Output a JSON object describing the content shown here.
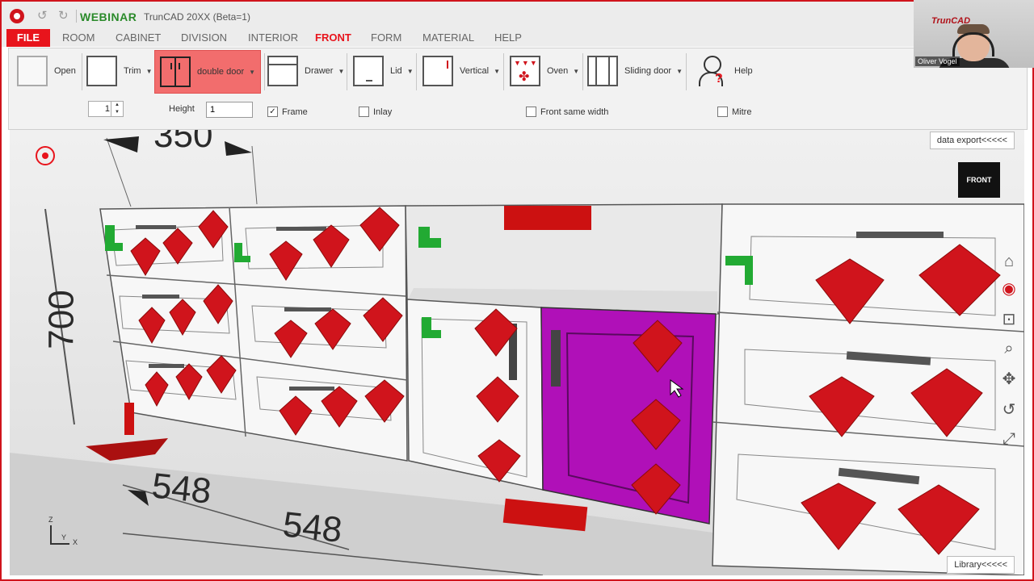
{
  "titlebar": {
    "brand": "WEBINAR",
    "app_title": "TrunCAD 20XX (Beta=1)"
  },
  "menubar": {
    "file": "FILE",
    "items": [
      "ROOM",
      "CABINET",
      "DIVISION",
      "INTERIOR",
      "FRONT",
      "FORM",
      "MATERIAL",
      "HELP"
    ],
    "active": "FRONT"
  },
  "ribbon": {
    "buttons": [
      {
        "label": "Open"
      },
      {
        "label": "Trim"
      },
      {
        "label": "double door"
      },
      {
        "label": "Drawer"
      },
      {
        "label": "Lid"
      },
      {
        "label": "Vertical"
      },
      {
        "label": "Oven"
      },
      {
        "label": "Sliding door"
      },
      {
        "label": "Help"
      }
    ],
    "active": "double door",
    "count_value": "1",
    "height_label": "Height",
    "height_value": "1",
    "options": {
      "frame": {
        "label": "Frame",
        "checked": true
      },
      "inlay": {
        "label": "Inlay",
        "checked": false
      },
      "front_same_width": {
        "label": "Front same width",
        "checked": false
      },
      "mitre": {
        "label": "Mitre",
        "checked": false
      }
    }
  },
  "viewport": {
    "data_export": "data export<<<<<",
    "library": "Library<<<<<",
    "cube_label": "FRONT",
    "dims": {
      "top": "350",
      "left": "700",
      "bottom1": "548",
      "bottom2": "548"
    },
    "axis_label": {
      "z": "Z",
      "y": "Y",
      "x": "X"
    },
    "colors": {
      "selected_door": "#b010b8",
      "arrow": "#d0141c",
      "marker": "#22aa33"
    }
  },
  "webcam": {
    "brand": "TrunCAD",
    "presenter": "Oliver Vogel"
  }
}
